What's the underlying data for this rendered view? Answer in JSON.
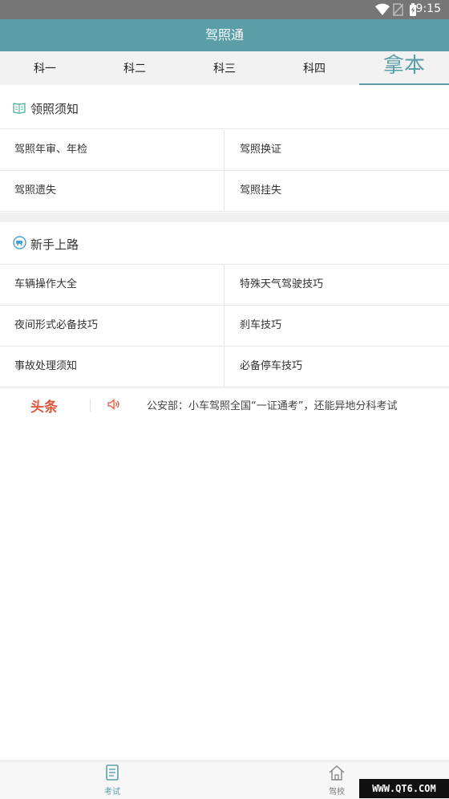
{
  "status_bar": {
    "time": "9:15"
  },
  "app_bar": {
    "title": "驾照通"
  },
  "tabs": [
    {
      "label": "科一"
    },
    {
      "label": "科二"
    },
    {
      "label": "科三"
    },
    {
      "label": "科四"
    },
    {
      "label": "拿本",
      "active": true
    }
  ],
  "license_notice": {
    "title": "领照须知",
    "items": [
      [
        "驾照年审、年检",
        "驾照换证"
      ],
      [
        "驾照遗失",
        "驾照挂失"
      ]
    ]
  },
  "new_driver": {
    "title": "新手上路",
    "items": [
      [
        "车辆操作大全",
        "特殊天气驾驶技巧"
      ],
      [
        "夜间形式必备技巧",
        "刹车技巧"
      ],
      [
        "事故处理须知",
        "必备停车技巧"
      ]
    ]
  },
  "headline": {
    "tag": "头条",
    "text": "公安部：小车驾照全国“一证通考”，还能异地分科考试"
  },
  "bottom_nav": [
    {
      "label": "考试",
      "icon": "document-icon",
      "active": true
    },
    {
      "label": "驾校",
      "icon": "home-icon",
      "active": false
    }
  ],
  "watermark": "WWW.QT6.COM",
  "colors": {
    "accent": "#5b9ea8",
    "headline_tag": "#e0543a",
    "status_bar": "#767676"
  }
}
